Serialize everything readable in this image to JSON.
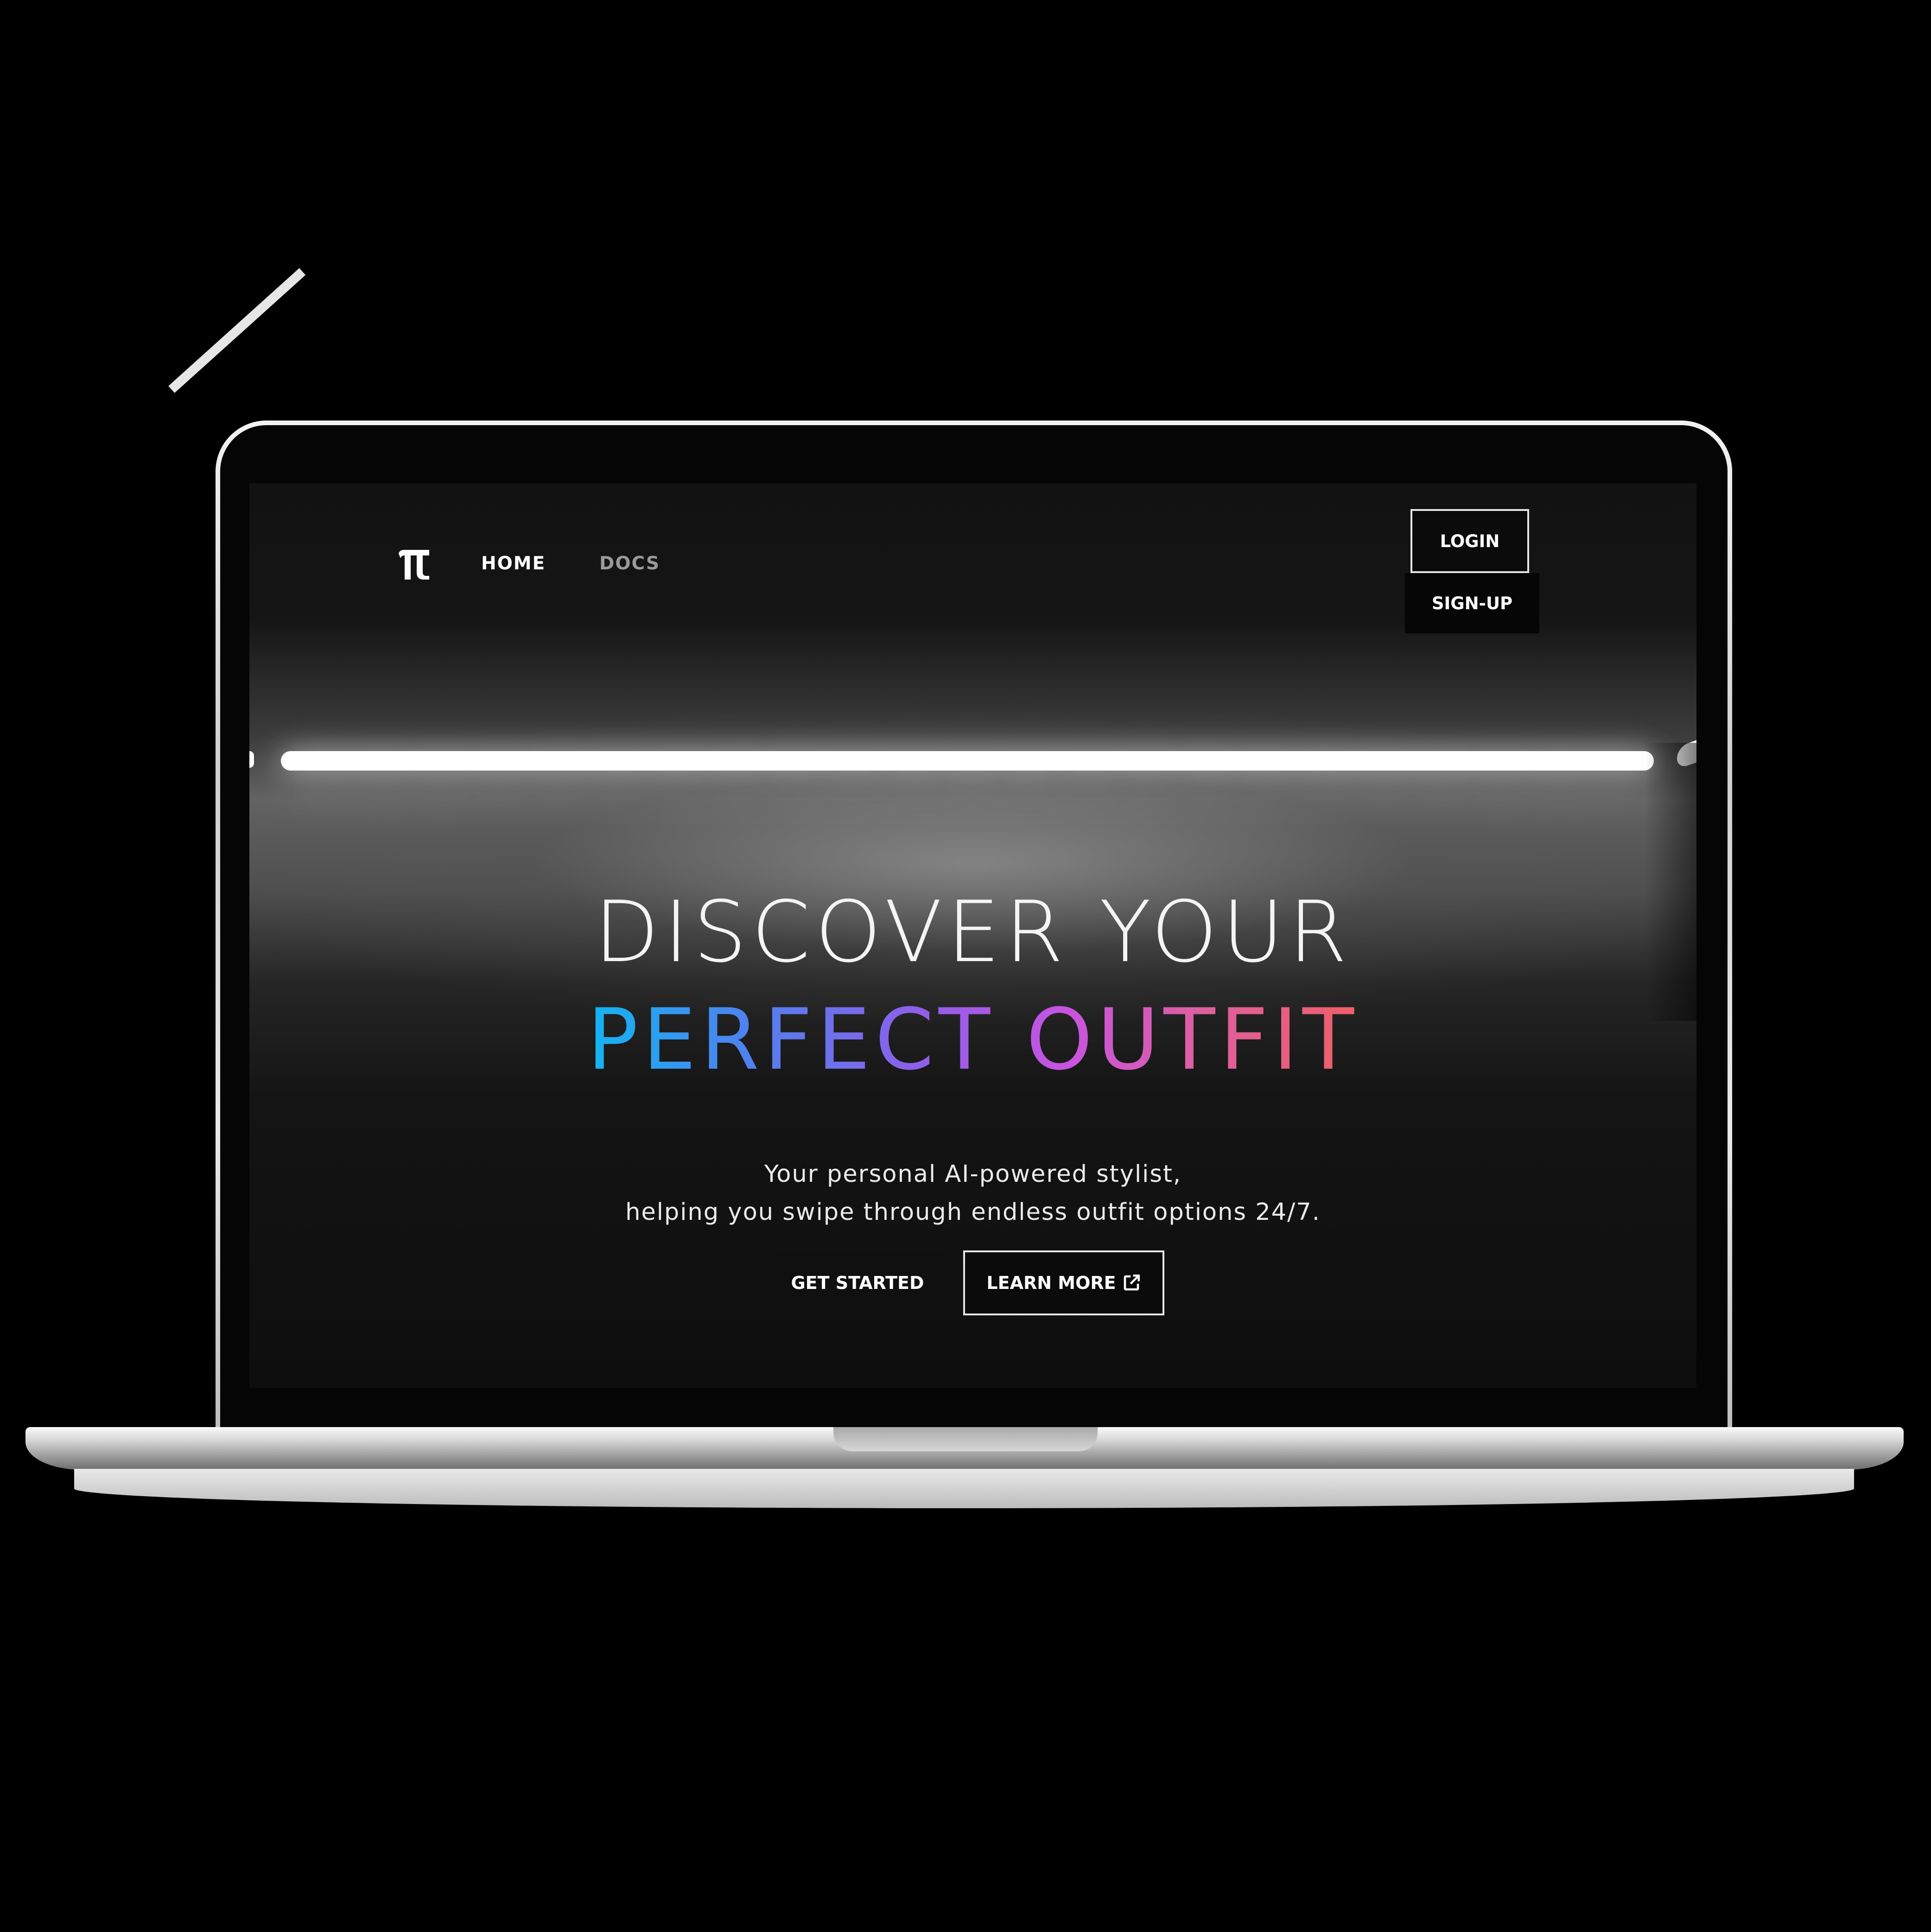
{
  "nav": {
    "logo_glyph": "π",
    "home_label": "HOME",
    "docs_label": "DOCS",
    "login_label": "LOGIN",
    "signup_label": "SIGN-UP"
  },
  "hero": {
    "title_line1": "DISCOVER YOUR",
    "title_line2": "PERFECT OUTFIT",
    "subtitle_line1": "Your personal AI-powered stylist,",
    "subtitle_line2": "helping you swipe through endless outfit options 24/7."
  },
  "actions": {
    "get_started_label": "GET STARTED",
    "learn_more_label": "LEARN MORE",
    "learn_more_icon": "external-link-icon"
  },
  "colors": {
    "background": "#000000",
    "gradient_start": "#12b5f2",
    "gradient_mid": "#c754e0",
    "gradient_end": "#ee5f67",
    "text": "#ffffff",
    "muted_nav": "#9a9a9a"
  }
}
